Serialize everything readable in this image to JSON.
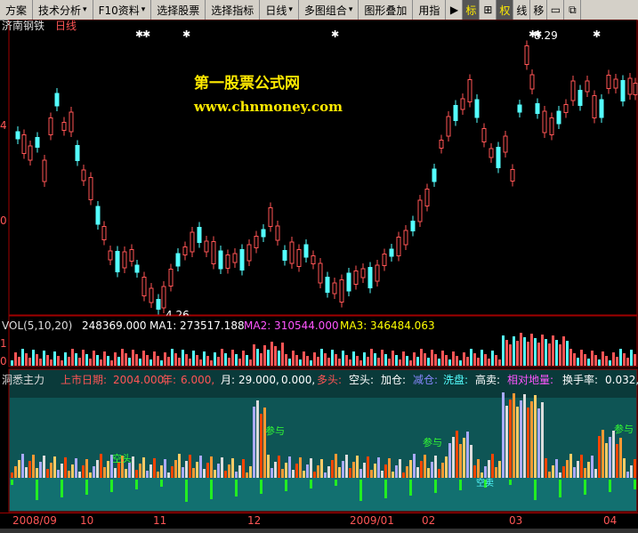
{
  "toolbar": {
    "items": [
      {
        "label": "方案",
        "dropdown": false
      },
      {
        "label": "技术分析",
        "dropdown": true
      },
      {
        "label": "F10资料",
        "dropdown": true
      },
      {
        "label": "选择股票",
        "dropdown": false
      },
      {
        "label": "选择指标",
        "dropdown": false
      },
      {
        "label": "日线",
        "dropdown": true
      },
      {
        "label": "多图组合",
        "dropdown": true
      },
      {
        "label": "图形叠加",
        "dropdown": false
      },
      {
        "label": "用指",
        "dropdown": false
      }
    ],
    "icons": [
      {
        "name": "play-icon",
        "glyph": "▶",
        "active": false
      },
      {
        "name": "tag-icon",
        "glyph": "标",
        "active": true
      },
      {
        "name": "crosshair-icon",
        "glyph": "⊞",
        "active": false
      },
      {
        "name": "rights-icon",
        "glyph": "权",
        "active": true
      },
      {
        "name": "line-icon",
        "glyph": "线",
        "active": false
      },
      {
        "name": "move-icon",
        "glyph": "移",
        "active": false
      },
      {
        "name": "window-icon",
        "glyph": "▭",
        "active": false
      },
      {
        "name": "restore-icon",
        "glyph": "⧉",
        "active": false
      }
    ]
  },
  "main": {
    "stock_name": "济南钢铁",
    "period": "日线",
    "high_label": "8.29",
    "low_label": "4.26",
    "watermark_title": "第一股票公式网",
    "watermark_url": "www.chnmoney.com",
    "y_tick_labels": [
      "4",
      "0"
    ]
  },
  "volume": {
    "header": "VOL(5,10,20)",
    "vol_value": "248369.000",
    "ma1": "MA1: 273517.188",
    "ma2": "MA2: 310544.000",
    "ma3": "MA3: 346484.063",
    "y_tick_labels": [
      "1",
      "0"
    ]
  },
  "indicator": {
    "name": "洞悉主力",
    "listing_label": "上市日期:",
    "listing_value": "2004.000,",
    "year_label": "年:",
    "year_value": "6.000,",
    "month_label": "月:",
    "month_value": "29.000,",
    "zero_value": "0.000,",
    "long_label": "多头:",
    "short_label": "空头:",
    "add_label": "加仓:",
    "reduce_label": "减仓:",
    "wash_label": "洗盘:",
    "sell_label": "高卖:",
    "relative_label": "相对地量:",
    "turnover_label": "换手率:",
    "turnover_value": "0.032,",
    "annotations": {
      "kongtou": "空头",
      "canyu": "参与",
      "hoarding": "囤货",
      "kongmai": "空卖"
    }
  },
  "date_axis": {
    "labels": [
      "2008/09",
      "10",
      "11",
      "12",
      "2009/01",
      "02",
      "03",
      "04"
    ]
  },
  "colors": {
    "up": "#ff5555",
    "down": "#54ffff",
    "ma1": "#ffffff",
    "ma2": "#ff00ff",
    "ma3": "#ffff00",
    "grid": "#a00000",
    "accent": "#ffea00"
  }
}
